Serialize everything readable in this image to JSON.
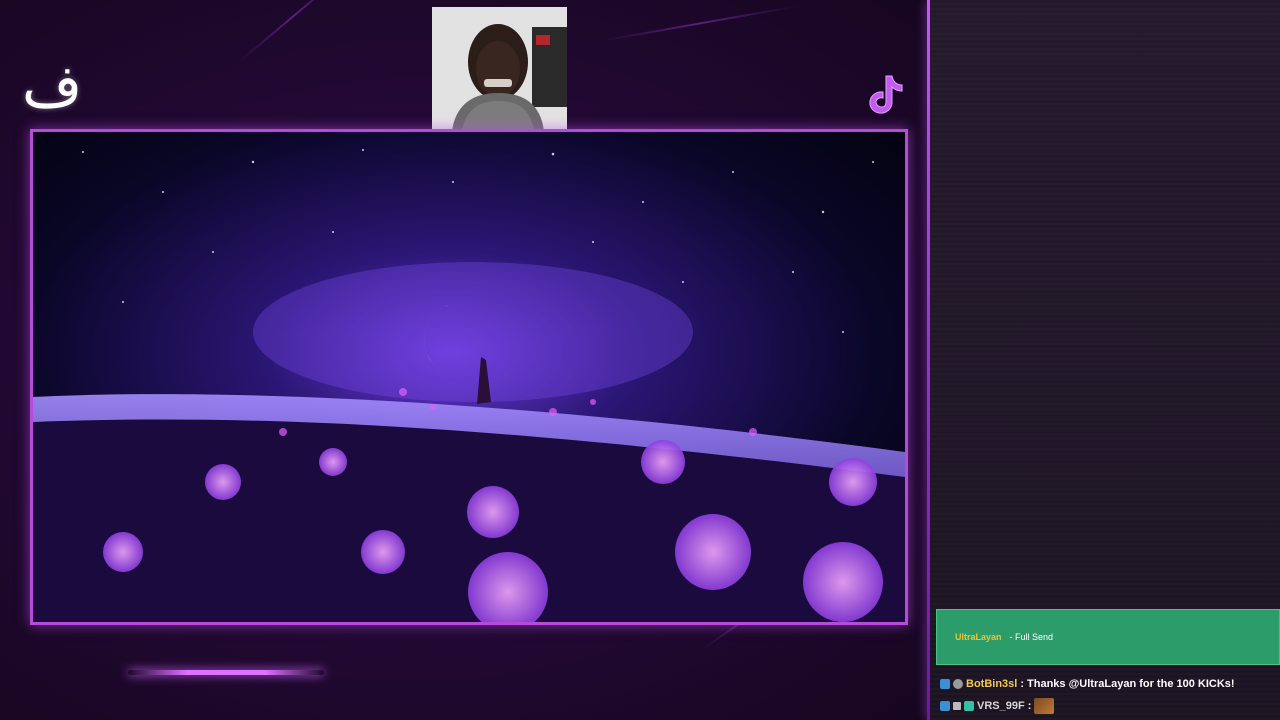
{
  "overlay": {
    "logo_text": "ف",
    "tiktok_icon": "tiktok-icon",
    "accent_color": "#b54bd8"
  },
  "alert": {
    "username": "UltraLayan",
    "message": "- Full Send",
    "background_color": "#2c9c6a"
  },
  "chat": {
    "messages": [
      {
        "badges": [
          "kick-badge",
          "bot-badge"
        ],
        "username": "BotBin3sl",
        "separator": ":",
        "text": "Thanks @UltraLayan for the 100 KICKs!"
      },
      {
        "badges": [
          "kick-badge",
          "small-badge",
          "teal-badge"
        ],
        "username": "VRS_99F",
        "separator": ":",
        "text": "",
        "emote": "emote-image"
      }
    ]
  }
}
